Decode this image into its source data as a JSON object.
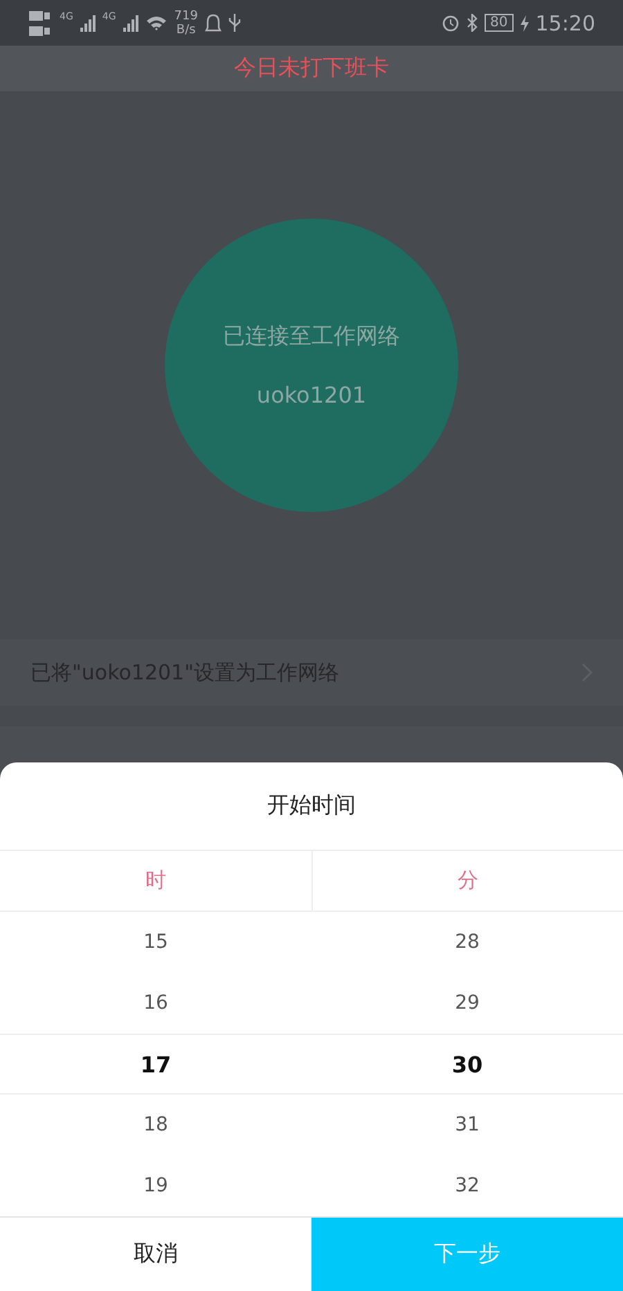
{
  "status_bar": {
    "network_1": "4G",
    "network_2": "4G",
    "speed_value": "719",
    "speed_unit": "B/s",
    "battery": "80",
    "time": "15:20"
  },
  "header": {
    "notice": "今日未打下班卡"
  },
  "connection": {
    "status": "已连接至工作网络",
    "network_name": "uoko1201"
  },
  "settings": [
    {
      "label": "已将\"uoko1201\"设置为工作网络"
    }
  ],
  "time_picker": {
    "title": "开始时间",
    "columns": [
      {
        "header": "时",
        "items": [
          {
            "label": "15",
            "selected": false
          },
          {
            "label": "16",
            "selected": false
          },
          {
            "label": "17",
            "selected": true
          },
          {
            "label": "18",
            "selected": false
          },
          {
            "label": "19",
            "selected": false
          }
        ]
      },
      {
        "header": "分",
        "items": [
          {
            "label": "28",
            "selected": false
          },
          {
            "label": "29",
            "selected": false
          },
          {
            "label": "30",
            "selected": true
          },
          {
            "label": "31",
            "selected": false
          },
          {
            "label": "32",
            "selected": false
          }
        ]
      }
    ],
    "buttons": [
      {
        "label": "取消",
        "kind": "secondary"
      },
      {
        "label": "下一步",
        "kind": "primary"
      }
    ]
  }
}
